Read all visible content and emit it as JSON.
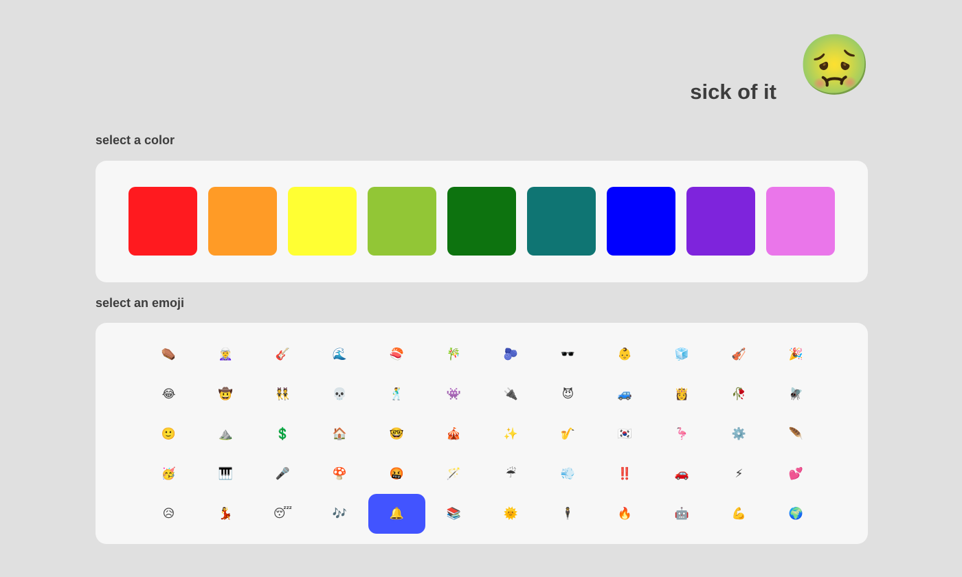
{
  "header": {
    "status_text": "sick of it",
    "status_emoji": "🤢"
  },
  "colors": {
    "label": "select a color",
    "swatches": [
      "#ff1a1f",
      "#ff9b26",
      "#ffff33",
      "#92c636",
      "#0d730f",
      "#0f7573",
      "#0000ff",
      "#7e24dc",
      "#ea76ea"
    ]
  },
  "emojis": {
    "label": "select an emoji",
    "selected_index": 52,
    "items": [
      "⚰️",
      "🧝‍♀️",
      "🎸",
      "🌊",
      "🍣",
      "🎋",
      "🫐",
      "🕶️",
      "👶",
      "🧊",
      "🎻",
      "🎉",
      "😂",
      "🤠",
      "👯",
      "💀",
      "🕺",
      "👾",
      "🔌",
      "😈",
      "🚙",
      "👸",
      "🥀",
      "🪰",
      "🙂",
      "⛰️",
      "💲",
      "🏠",
      "🤓",
      "🎪",
      "✨",
      "🎷",
      "🇰🇷",
      "🦩",
      "⚙️",
      "🪶",
      "🥳",
      "🎹",
      "🎤",
      "🍄",
      "🤬",
      "🪄",
      "☔",
      "💨",
      "‼️",
      "🚗",
      "⚡",
      "💕",
      "😥",
      "💃",
      "😴",
      "🎶",
      "🔔",
      "📚",
      "🌞",
      "🕴️",
      "🔥",
      "🤖",
      "💪",
      "🌍"
    ]
  }
}
